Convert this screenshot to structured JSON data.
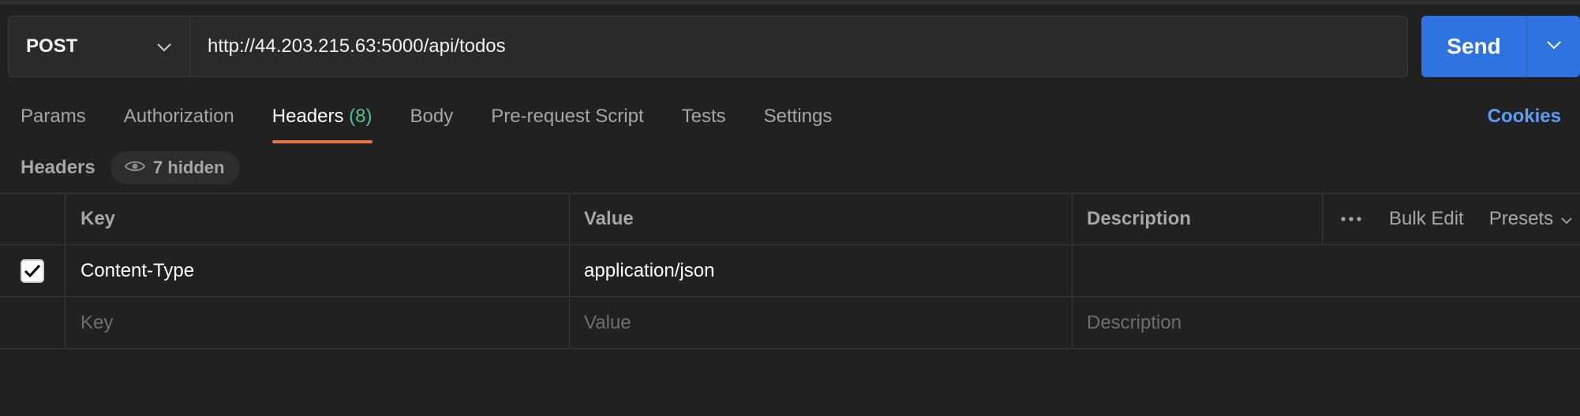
{
  "request": {
    "method": "POST",
    "url": "http://44.203.215.63:5000/api/todos",
    "send_label": "Send"
  },
  "tabs": [
    {
      "label": "Params"
    },
    {
      "label": "Authorization"
    },
    {
      "label": "Headers",
      "count": "(8)"
    },
    {
      "label": "Body"
    },
    {
      "label": "Pre-request Script"
    },
    {
      "label": "Tests"
    },
    {
      "label": "Settings"
    }
  ],
  "cookies_label": "Cookies",
  "headers_section": {
    "title": "Headers",
    "hidden_label": "7 hidden"
  },
  "table": {
    "columns": {
      "key": "Key",
      "value": "Value",
      "description": "Description"
    },
    "actions": {
      "bulk_edit": "Bulk Edit",
      "presets": "Presets"
    },
    "rows": [
      {
        "checked": true,
        "key": "Content-Type",
        "value": "application/json",
        "description": ""
      }
    ],
    "placeholders": {
      "key": "Key",
      "value": "Value",
      "description": "Description"
    }
  },
  "colors": {
    "background": "#212121",
    "send_button": "#2f73e0",
    "active_tab_underline": "#e8734a",
    "count_green": "#4fc38a",
    "link_blue": "#5e9df5"
  },
  "icons": [
    "chevron-down-icon",
    "eye-icon",
    "checkmark-icon",
    "more-horizontal-icon"
  ]
}
